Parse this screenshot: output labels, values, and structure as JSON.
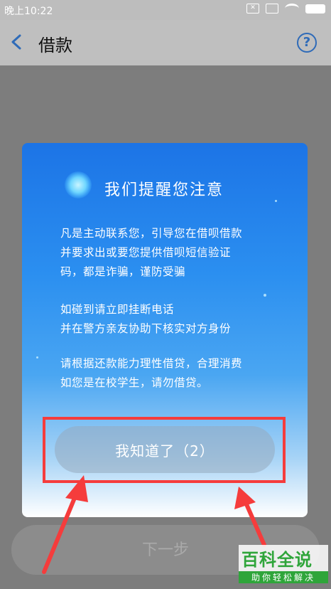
{
  "status_bar": {
    "time": "晚上10:22",
    "icons": [
      "sim-blocked-icon",
      "notification-off-icon",
      "wifi-icon",
      "battery-charging-icon"
    ]
  },
  "nav": {
    "title": "借款",
    "help_symbol": "?"
  },
  "modal": {
    "title": "我们提醒您注意",
    "paragraph1": [
      "凡是主动联系您，引导您在借呗借款",
      "并要求出或要您提供借呗短信验证",
      "码，都是诈骗，谨防受骗"
    ],
    "paragraph2": [
      "如碰到请立即挂断电话",
      "并在警方亲友协助下核实对方身份"
    ],
    "paragraph3": [
      "请根据还款能力理性借贷，合理消费",
      "如您是在校学生，请勿借贷。"
    ],
    "confirm_label": "我知道了（2）"
  },
  "page": {
    "next_label": "下一步"
  },
  "watermark": {
    "main": "百科全说",
    "sub": "助你轻松解决"
  },
  "colors": {
    "highlight": "#f53c3c",
    "modal_top": "#1c74e6",
    "watermark_green": "#2fa53a"
  }
}
